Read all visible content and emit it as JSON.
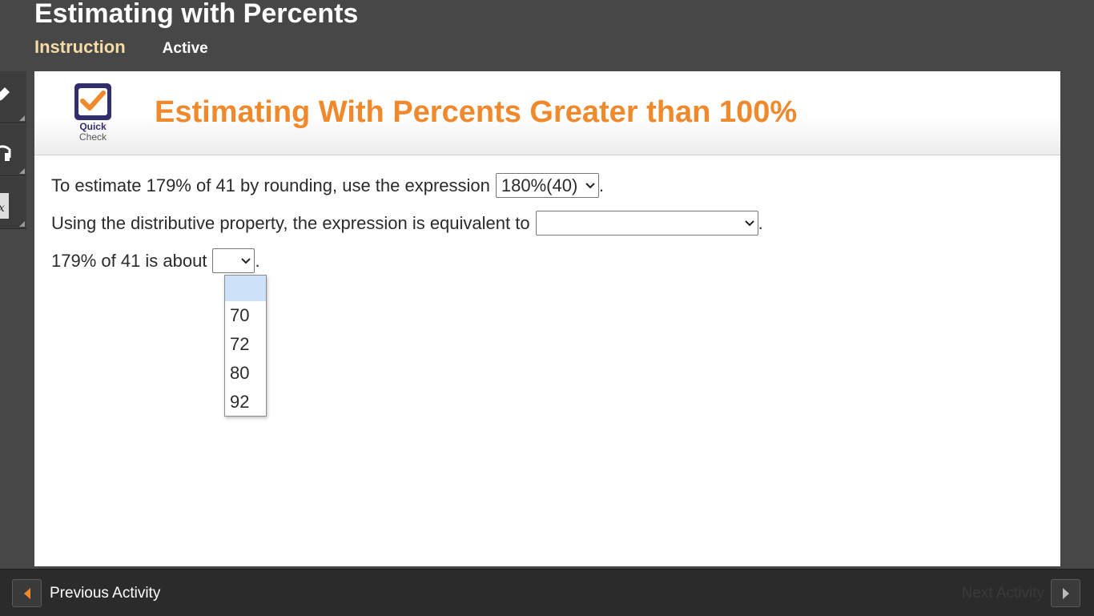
{
  "app": {
    "title": "Estimating with Percents"
  },
  "tabs": [
    {
      "label": "Instruction"
    },
    {
      "label": "Active"
    }
  ],
  "sidebar": {
    "tools": [
      {
        "icon": "pencil-icon"
      },
      {
        "icon": "headphones-icon"
      },
      {
        "icon": "calculator-icon",
        "glyph": "x"
      }
    ]
  },
  "panel": {
    "logo_line1": "Quick",
    "logo_line2": "Check",
    "title": "Estimating With Percents Greater than 100%",
    "accent_color": "#f0892c"
  },
  "questions": [
    {
      "prompt": "To estimate 179% of 41 by rounding, use the expression",
      "selected": "180%(40)",
      "suffix": "."
    },
    {
      "prompt": "Using the distributive property, the expression is equivalent to",
      "selected": "",
      "suffix": "."
    },
    {
      "prompt": "179% of 41 is about",
      "selected": "",
      "suffix": ".",
      "options": [
        "",
        "70",
        "72",
        "80",
        "92"
      ]
    }
  ],
  "footer": {
    "prev_label": "Previous Activity",
    "next_label": "Next Activity",
    "arrow_color": "#f0892c"
  }
}
